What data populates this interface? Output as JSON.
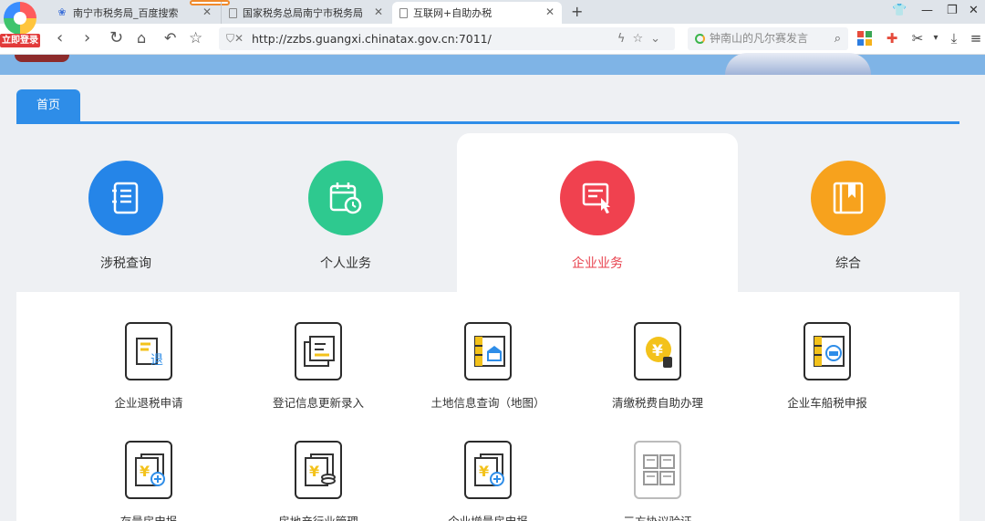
{
  "browser": {
    "login_badge": "立即登录",
    "tabs": [
      {
        "title": "南宁市税务局_百度搜索"
      },
      {
        "title": "国家税务总局南宁市税务局"
      },
      {
        "title": "互联网+自助办税"
      }
    ],
    "url": "http://zzbs.guangxi.chinatax.gov.cn:7011/",
    "search_placeholder": "钟南山的凡尔赛发言",
    "icons": [
      "shirt-icon",
      "minimize-icon",
      "restore-icon",
      "close-icon",
      "back-icon",
      "forward-icon",
      "refresh-icon",
      "home-icon",
      "undo-icon",
      "star-icon",
      "shield-icon",
      "lightning-icon",
      "bookmark-icon",
      "chevron-down-icon",
      "search-icon",
      "apps-icon",
      "game-icon",
      "scissors-icon",
      "download-icon",
      "menu-icon"
    ]
  },
  "page": {
    "nav_tab": "首页",
    "categories": [
      {
        "label": "涉税查询",
        "color": "#2585e8",
        "icon": "notebook-icon"
      },
      {
        "label": "个人业务",
        "color": "#2ec98f",
        "icon": "calendar-clock-icon"
      },
      {
        "label": "企业业务",
        "color": "#f0414f",
        "icon": "form-hand-icon"
      },
      {
        "label": "综合",
        "color": "#f7a21d",
        "icon": "book-icon"
      }
    ],
    "active_category": "企业业务",
    "services": [
      {
        "label": "企业退税申请",
        "icon": "refund-form-icon"
      },
      {
        "label": "登记信息更新录入",
        "icon": "register-update-icon"
      },
      {
        "label": "土地信息查询（地图）",
        "icon": "land-query-icon"
      },
      {
        "label": "清缴税费自助办理",
        "icon": "yuan-payment-icon"
      },
      {
        "label": "企业车船税申报",
        "icon": "vehicle-tax-icon"
      },
      {
        "label": "存量房申报",
        "icon": "yuan-docs-plus-icon"
      },
      {
        "label": "房地产行业管理",
        "icon": "yuan-docs-coins-icon"
      },
      {
        "label": "企业增量房申报",
        "icon": "yuan-docs-plus-icon"
      },
      {
        "label": "三方协议验证",
        "icon": "agreement-check-icon"
      }
    ]
  }
}
